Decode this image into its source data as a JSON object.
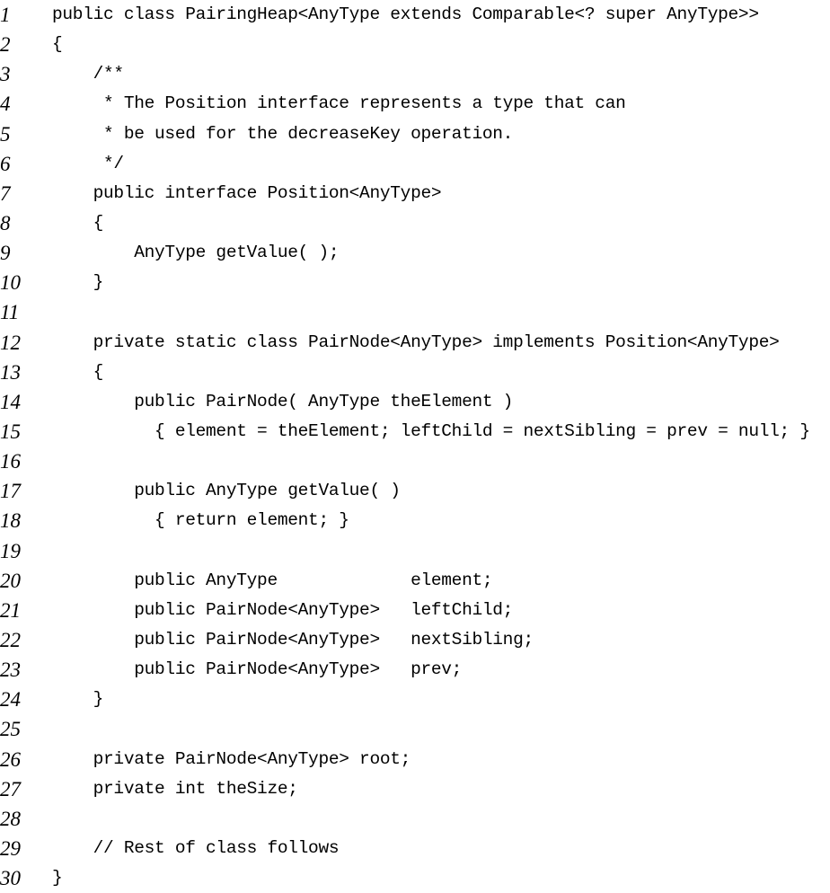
{
  "listing": {
    "lines": [
      {
        "num": "1",
        "code": "public class PairingHeap<AnyType extends Comparable<? super AnyType>>"
      },
      {
        "num": "2",
        "code": "{"
      },
      {
        "num": "3",
        "code": "    /**"
      },
      {
        "num": "4",
        "code": "     * The Position interface represents a type that can"
      },
      {
        "num": "5",
        "code": "     * be used for the decreaseKey operation."
      },
      {
        "num": "6",
        "code": "     */"
      },
      {
        "num": "7",
        "code": "    public interface Position<AnyType>"
      },
      {
        "num": "8",
        "code": "    {"
      },
      {
        "num": "9",
        "code": "        AnyType getValue( );"
      },
      {
        "num": "10",
        "code": "    }"
      },
      {
        "num": "11",
        "code": ""
      },
      {
        "num": "12",
        "code": "    private static class PairNode<AnyType> implements Position<AnyType>"
      },
      {
        "num": "13",
        "code": "    {"
      },
      {
        "num": "14",
        "code": "        public PairNode( AnyType theElement )"
      },
      {
        "num": "15",
        "code": "          { element = theElement; leftChild = nextSibling = prev = null; }"
      },
      {
        "num": "16",
        "code": ""
      },
      {
        "num": "17",
        "code": "        public AnyType getValue( )"
      },
      {
        "num": "18",
        "code": "          { return element; }"
      },
      {
        "num": "19",
        "code": ""
      },
      {
        "num": "20",
        "code": "        public AnyType             element;"
      },
      {
        "num": "21",
        "code": "        public PairNode<AnyType>   leftChild;"
      },
      {
        "num": "22",
        "code": "        public PairNode<AnyType>   nextSibling;"
      },
      {
        "num": "23",
        "code": "        public PairNode<AnyType>   prev;"
      },
      {
        "num": "24",
        "code": "    }"
      },
      {
        "num": "25",
        "code": ""
      },
      {
        "num": "26",
        "code": "    private PairNode<AnyType> root;"
      },
      {
        "num": "27",
        "code": "    private int theSize;"
      },
      {
        "num": "28",
        "code": ""
      },
      {
        "num": "29",
        "code": "    // Rest of class follows"
      },
      {
        "num": "30",
        "code": "}"
      }
    ]
  }
}
